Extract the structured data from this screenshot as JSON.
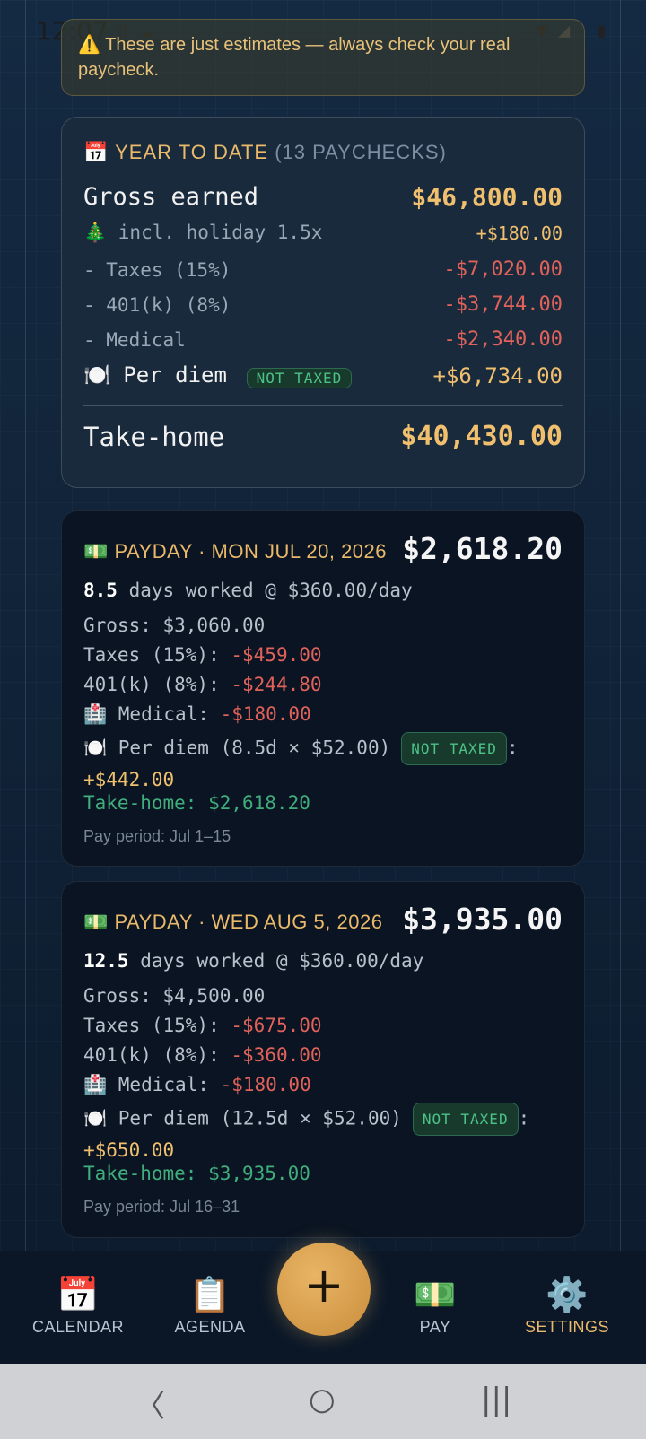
{
  "status_bar": {
    "time": "12:07"
  },
  "banner": {
    "icon": "warning-icon",
    "text": "⚠️ These are just estimates — always check your real paycheck."
  },
  "ytd": {
    "icon": "📅",
    "title": "YEAR TO DATE",
    "subtitle": "(13 PAYCHECKS)",
    "gross_label": "Gross earned",
    "gross_value": "$46,800.00",
    "holiday_label": "🎄 incl. holiday 1.5x",
    "holiday_value": "+$180.00",
    "taxes_label": "- Taxes (15%)",
    "taxes_value": "-$7,020.00",
    "k401_label": "- 401(k) (8%)",
    "k401_value": "-$3,744.00",
    "medical_label": "- Medical",
    "medical_value": "-$2,340.00",
    "perdiem_label": "🍽️ Per diem",
    "perdiem_tag": "NOT TAXED",
    "perdiem_value": "+$6,734.00",
    "takehome_label": "Take-home",
    "takehome_value": "$40,430.00"
  },
  "paydays": [
    {
      "header": "💵 PAYDAY · MON JUL 20, 2026",
      "total": "$2,618.20",
      "days": "8.5",
      "days_text": "days worked  @  $360.00/day",
      "gross": "Gross: $3,060.00",
      "taxes_label": "Taxes (15%): ",
      "taxes_value": "-$459.00",
      "k401_label": "401(k) (8%): ",
      "k401_value": "-$244.80",
      "medical_label": "🏥 Medical: ",
      "medical_value": "-$180.00",
      "perdiem_label": "🍽️ Per diem (8.5d × $52.00)",
      "perdiem_tag": "NOT TAXED",
      "perdiem_value": "+$442.00",
      "takehome": "Take-home: $2,618.20",
      "period": "Pay period: Jul 1–15"
    },
    {
      "header": "💵 PAYDAY · WED AUG 5, 2026",
      "total": "$3,935.00",
      "days": "12.5",
      "days_text": "days worked  @  $360.00/day",
      "gross": "Gross: $4,500.00",
      "taxes_label": "Taxes (15%): ",
      "taxes_value": "-$675.00",
      "k401_label": "401(k) (8%): ",
      "k401_value": "-$360.00",
      "medical_label": "🏥 Medical: ",
      "medical_value": "-$180.00",
      "perdiem_label": "🍽️ Per diem (12.5d × $52.00)",
      "perdiem_tag": "NOT TAXED",
      "perdiem_value": "+$650.00",
      "takehome": "Take-home: $3,935.00",
      "period": "Pay period: Jul 16–31"
    }
  ],
  "nav": {
    "calendar": {
      "icon": "📅",
      "label": "CALENDAR"
    },
    "agenda": {
      "icon": "📋",
      "label": "AGENDA"
    },
    "add": {
      "icon": "+"
    },
    "pay": {
      "icon": "💵",
      "label": "PAY"
    },
    "settings": {
      "icon": "⚙️",
      "label": "SETTINGS",
      "active": true
    }
  },
  "colors": {
    "accent": "#eab96a",
    "negative": "#e0625a",
    "positive_green": "#3fae7c",
    "background": "#0c1a2b"
  }
}
